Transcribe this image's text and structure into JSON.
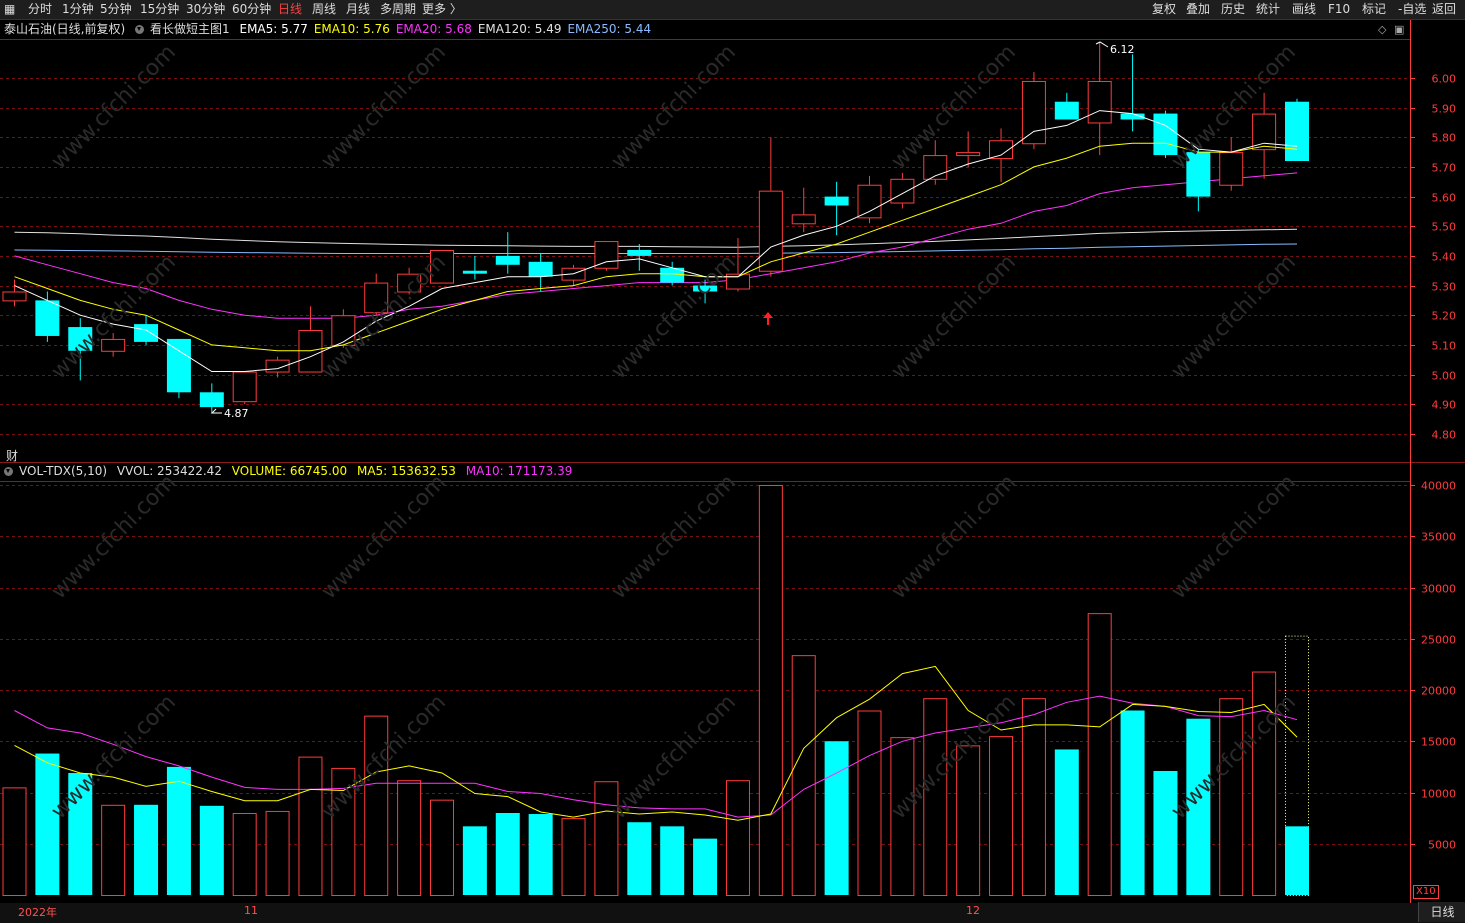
{
  "toolbar": {
    "timeframes": [
      "分时",
      "1分钟",
      "5分钟",
      "15分钟",
      "30分钟",
      "60分钟",
      "日线",
      "周线",
      "月线",
      "多周期",
      "更多 〉"
    ],
    "active_timeframe": "日线",
    "tools": [
      "复权",
      "叠加",
      "历史",
      "统计",
      "画线",
      "F10",
      "标记",
      "-自选",
      "返回"
    ]
  },
  "price_panel": {
    "stock": "泰山石油(日线,前复权)",
    "indicator_name": "看长做短主图1",
    "ema": [
      {
        "label": "EMA5: 5.77",
        "color": "#ffffff"
      },
      {
        "label": "EMA10: 5.76",
        "color": "#ffff00"
      },
      {
        "label": "EMA20: 5.68",
        "color": "#ff33ff"
      },
      {
        "label": "EMA120: 5.49",
        "color": "#e0e0e0"
      },
      {
        "label": "EMA250: 5.44",
        "color": "#88bbff"
      }
    ],
    "high_label": "6.12",
    "low_label": "4.87"
  },
  "volume_panel": {
    "cai_label": "财",
    "title": "VOL-TDX(5,10)",
    "vvol": "VVOL: 253422.42",
    "volume": "VOLUME: 66745.00",
    "ma5": "MA5: 153632.53",
    "ma10": "MA10: 171173.39",
    "x10_label": "X10"
  },
  "bottom": {
    "year_label": "2022年",
    "month_labels": [
      "11",
      "12"
    ],
    "period_button": "日线"
  },
  "colors": {
    "up": "#ff3c3c",
    "down": "#00ffff",
    "ema5": "#ffffff",
    "ema10": "#ffff00",
    "ema20": "#ff33ff",
    "ema120": "#e0e0e0",
    "ema250": "#88bbff",
    "axis": "#ff3c3c"
  },
  "chart_data": [
    {
      "type": "candlestick",
      "yticks": [
        6.0,
        5.9,
        5.8,
        5.7,
        5.6,
        5.5,
        5.4,
        5.3,
        5.2,
        5.1,
        5.0,
        4.9,
        4.8
      ],
      "ylim": [
        4.76,
        6.18
      ],
      "candles": [
        {
          "o": 5.25,
          "h": 5.32,
          "l": 5.23,
          "c": 5.28
        },
        {
          "o": 5.25,
          "h": 5.28,
          "l": 5.11,
          "c": 5.13
        },
        {
          "o": 5.16,
          "h": 5.19,
          "l": 4.98,
          "c": 5.08
        },
        {
          "o": 5.08,
          "h": 5.14,
          "l": 5.06,
          "c": 5.12
        },
        {
          "o": 5.17,
          "h": 5.2,
          "l": 5.1,
          "c": 5.11
        },
        {
          "o": 5.12,
          "h": 5.12,
          "l": 4.92,
          "c": 4.94
        },
        {
          "o": 4.94,
          "h": 4.97,
          "l": 4.87,
          "c": 4.89
        },
        {
          "o": 4.91,
          "h": 5.01,
          "l": 4.9,
          "c": 5.01
        },
        {
          "o": 5.01,
          "h": 5.06,
          "l": 4.99,
          "c": 5.05
        },
        {
          "o": 5.01,
          "h": 5.23,
          "l": 5.01,
          "c": 5.15
        },
        {
          "o": 5.1,
          "h": 5.22,
          "l": 5.09,
          "c": 5.2
        },
        {
          "o": 5.21,
          "h": 5.34,
          "l": 5.2,
          "c": 5.31
        },
        {
          "o": 5.28,
          "h": 5.36,
          "l": 5.27,
          "c": 5.34
        },
        {
          "o": 5.31,
          "h": 5.42,
          "l": 5.31,
          "c": 5.42
        },
        {
          "o": 5.35,
          "h": 5.4,
          "l": 5.32,
          "c": 5.34
        },
        {
          "o": 5.4,
          "h": 5.48,
          "l": 5.34,
          "c": 5.37
        },
        {
          "o": 5.38,
          "h": 5.41,
          "l": 5.28,
          "c": 5.33
        },
        {
          "o": 5.32,
          "h": 5.37,
          "l": 5.3,
          "c": 5.36
        },
        {
          "o": 5.36,
          "h": 5.45,
          "l": 5.35,
          "c": 5.45
        },
        {
          "o": 5.42,
          "h": 5.44,
          "l": 5.35,
          "c": 5.4
        },
        {
          "o": 5.36,
          "h": 5.38,
          "l": 5.3,
          "c": 5.31
        },
        {
          "o": 5.3,
          "h": 5.32,
          "l": 5.24,
          "c": 5.28
        },
        {
          "o": 5.29,
          "h": 5.46,
          "l": 5.28,
          "c": 5.34
        },
        {
          "o": 5.35,
          "h": 5.8,
          "l": 5.33,
          "c": 5.62
        },
        {
          "o": 5.51,
          "h": 5.63,
          "l": 5.48,
          "c": 5.54
        },
        {
          "o": 5.6,
          "h": 5.65,
          "l": 5.47,
          "c": 5.57
        },
        {
          "o": 5.53,
          "h": 5.67,
          "l": 5.51,
          "c": 5.64
        },
        {
          "o": 5.58,
          "h": 5.68,
          "l": 5.56,
          "c": 5.66
        },
        {
          "o": 5.66,
          "h": 5.79,
          "l": 5.64,
          "c": 5.74
        },
        {
          "o": 5.74,
          "h": 5.82,
          "l": 5.7,
          "c": 5.75
        },
        {
          "o": 5.73,
          "h": 5.83,
          "l": 5.65,
          "c": 5.79
        },
        {
          "o": 5.78,
          "h": 6.02,
          "l": 5.76,
          "c": 5.99
        },
        {
          "o": 5.92,
          "h": 5.95,
          "l": 5.86,
          "c": 5.86
        },
        {
          "o": 5.85,
          "h": 6.12,
          "l": 5.74,
          "c": 5.99
        },
        {
          "o": 5.88,
          "h": 6.08,
          "l": 5.82,
          "c": 5.86
        },
        {
          "o": 5.88,
          "h": 5.89,
          "l": 5.73,
          "c": 5.74
        },
        {
          "o": 5.75,
          "h": 5.76,
          "l": 5.55,
          "c": 5.6
        },
        {
          "o": 5.64,
          "h": 5.8,
          "l": 5.62,
          "c": 5.75
        },
        {
          "o": 5.76,
          "h": 5.95,
          "l": 5.66,
          "c": 5.88
        },
        {
          "o": 5.92,
          "h": 5.93,
          "l": 5.72,
          "c": 5.72
        }
      ],
      "ema5": [
        5.3,
        5.25,
        5.2,
        5.17,
        5.15,
        5.08,
        5.01,
        5.01,
        5.02,
        5.06,
        5.11,
        5.18,
        5.23,
        5.29,
        5.31,
        5.33,
        5.33,
        5.34,
        5.38,
        5.39,
        5.36,
        5.33,
        5.33,
        5.43,
        5.47,
        5.5,
        5.55,
        5.61,
        5.67,
        5.71,
        5.74,
        5.82,
        5.84,
        5.89,
        5.88,
        5.84,
        5.76,
        5.75,
        5.78,
        5.77
      ],
      "ema10": [
        5.33,
        5.29,
        5.25,
        5.22,
        5.2,
        5.15,
        5.1,
        5.09,
        5.08,
        5.08,
        5.1,
        5.14,
        5.18,
        5.22,
        5.25,
        5.28,
        5.29,
        5.3,
        5.33,
        5.34,
        5.34,
        5.33,
        5.33,
        5.38,
        5.41,
        5.44,
        5.48,
        5.52,
        5.56,
        5.6,
        5.64,
        5.7,
        5.73,
        5.77,
        5.78,
        5.78,
        5.75,
        5.75,
        5.77,
        5.76
      ],
      "ema20": [
        5.4,
        5.37,
        5.34,
        5.31,
        5.29,
        5.25,
        5.22,
        5.2,
        5.19,
        5.19,
        5.19,
        5.2,
        5.22,
        5.23,
        5.25,
        5.27,
        5.28,
        5.29,
        5.3,
        5.31,
        5.31,
        5.31,
        5.32,
        5.34,
        5.36,
        5.38,
        5.41,
        5.43,
        5.46,
        5.49,
        5.51,
        5.55,
        5.57,
        5.61,
        5.63,
        5.64,
        5.65,
        5.66,
        5.67,
        5.68
      ],
      "ema120": [
        5.48,
        5.478,
        5.475,
        5.47,
        5.467,
        5.462,
        5.456,
        5.452,
        5.448,
        5.445,
        5.442,
        5.44,
        5.438,
        5.436,
        5.435,
        5.434,
        5.433,
        5.432,
        5.432,
        5.432,
        5.431,
        5.43,
        5.429,
        5.432,
        5.434,
        5.437,
        5.441,
        5.445,
        5.449,
        5.454,
        5.459,
        5.465,
        5.47,
        5.476,
        5.479,
        5.482,
        5.484,
        5.486,
        5.488,
        5.49
      ],
      "ema250": [
        5.42,
        5.419,
        5.418,
        5.417,
        5.416,
        5.414,
        5.412,
        5.411,
        5.41,
        5.409,
        5.408,
        5.408,
        5.408,
        5.408,
        5.408,
        5.408,
        5.408,
        5.408,
        5.408,
        5.408,
        5.408,
        5.408,
        5.408,
        5.409,
        5.41,
        5.411,
        5.413,
        5.415,
        5.417,
        5.419,
        5.421,
        5.424,
        5.426,
        5.429,
        5.431,
        5.433,
        5.435,
        5.437,
        5.439,
        5.44
      ]
    },
    {
      "type": "bar",
      "yticks": [
        40000,
        35000,
        30000,
        25000,
        20000,
        15000,
        10000,
        5000
      ],
      "ylim": [
        0,
        41000
      ],
      "volume": [
        10500,
        13800,
        11900,
        8800,
        8800,
        12500,
        8700,
        8000,
        8200,
        13500,
        12400,
        17500,
        11200,
        9300,
        6700,
        8000,
        7900,
        7500,
        11100,
        7100,
        6700,
        5500,
        11200,
        40000,
        23400,
        15000,
        18000,
        15400,
        19200,
        14600,
        15500,
        19200,
        14200,
        27500,
        18000,
        12100,
        17200,
        19200,
        21800,
        25300
      ],
      "volume_filled_today": 6700,
      "ma5": [
        14600,
        12900,
        11900,
        11500,
        10600,
        11100,
        10100,
        9200,
        9200,
        10300,
        10200,
        12000,
        12600,
        11900,
        9900,
        9600,
        8100,
        7600,
        8200,
        7900,
        8100,
        7800,
        7300,
        7900,
        14300,
        17300,
        19100,
        21600,
        22300,
        18000,
        16100,
        16600,
        16600,
        16400,
        18600,
        18400,
        17900,
        17800,
        18600,
        15400
      ],
      "ma10": [
        18000,
        16300,
        15800,
        14700,
        13500,
        12600,
        11500,
        10500,
        10300,
        10300,
        10400,
        10900,
        10900,
        10900,
        10900,
        10100,
        9900,
        9300,
        8800,
        8500,
        8400,
        8400,
        7600,
        7800,
        10300,
        11900,
        13600,
        15000,
        15800,
        16300,
        16800,
        17600,
        18800,
        19400,
        18700,
        18400,
        17500,
        17400,
        18000,
        17100
      ]
    }
  ]
}
